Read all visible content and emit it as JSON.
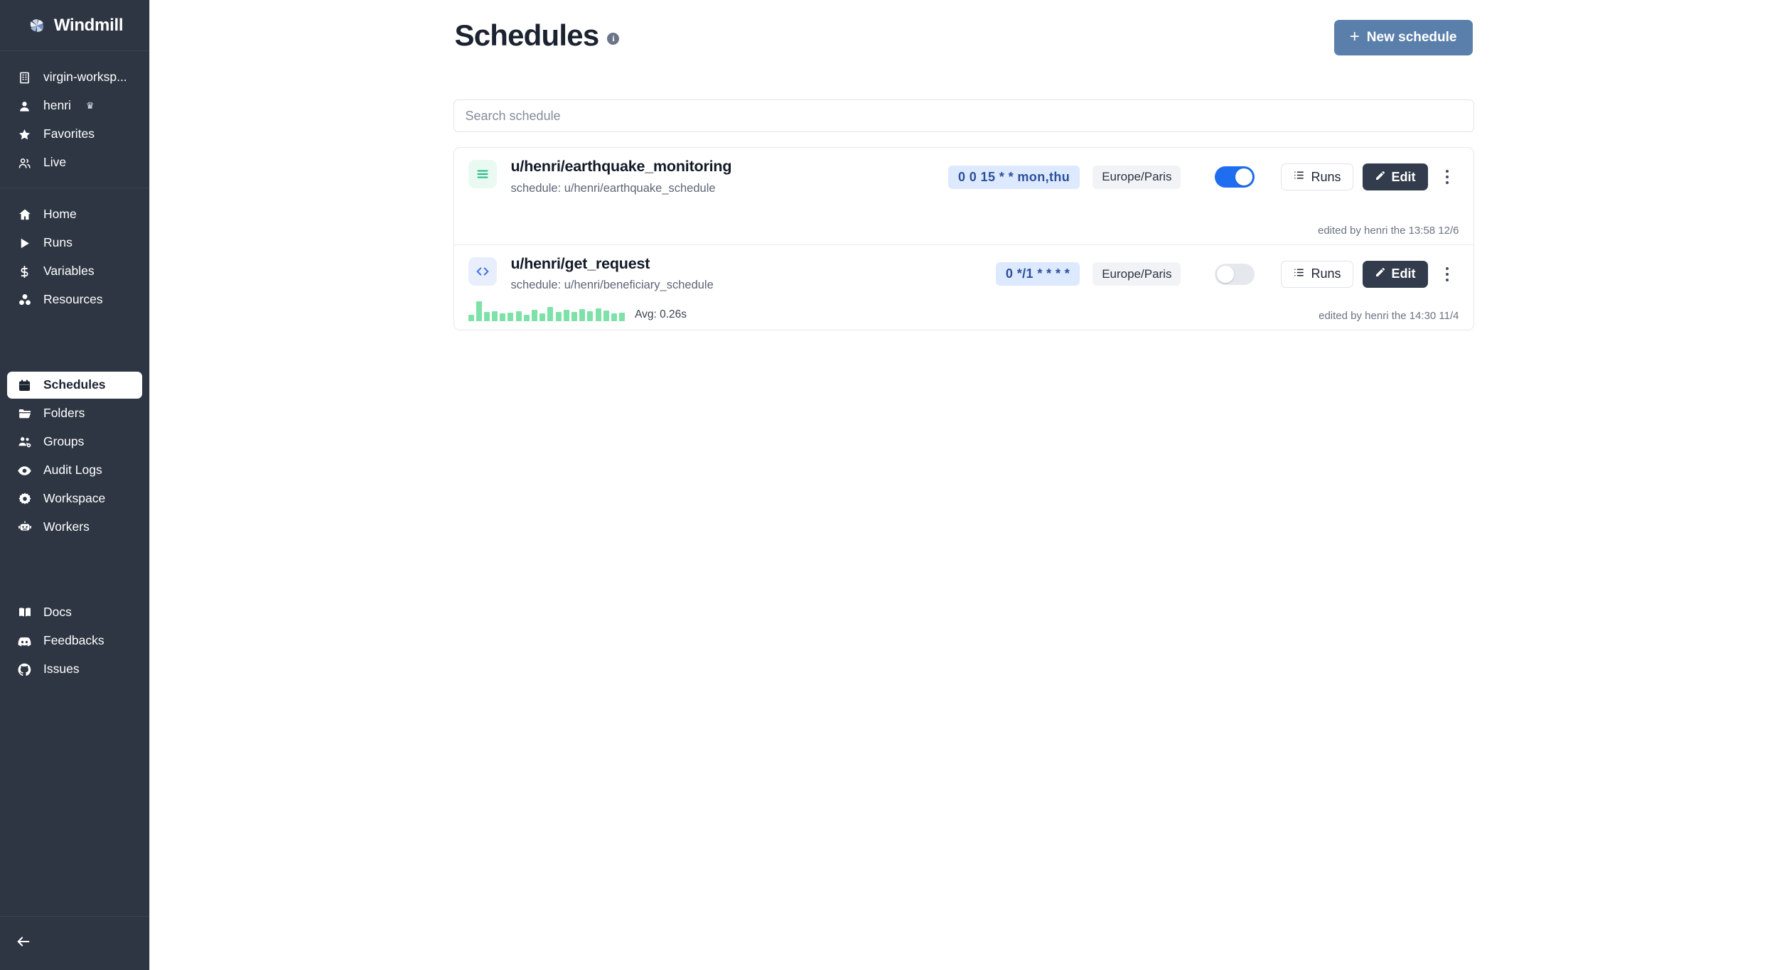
{
  "app": {
    "name": "Windmill",
    "logo_icon": "windmill-logo-icon"
  },
  "sidebar": {
    "workspace": {
      "label": "virgin-worksp...",
      "icon": "building-icon"
    },
    "user": {
      "label": "henri",
      "icon": "user-icon",
      "badge": "♛"
    },
    "top_items": [
      {
        "label": "Favorites",
        "icon": "star-icon"
      },
      {
        "label": "Live",
        "icon": "users-icon"
      }
    ],
    "main_items": [
      {
        "label": "Home",
        "icon": "home-icon"
      },
      {
        "label": "Runs",
        "icon": "play-icon"
      },
      {
        "label": "Variables",
        "icon": "dollar-icon"
      },
      {
        "label": "Resources",
        "icon": "resources-icon"
      }
    ],
    "admin_items": [
      {
        "label": "Schedules",
        "icon": "calendar-icon",
        "active": true
      },
      {
        "label": "Folders",
        "icon": "folder-icon",
        "active": false
      },
      {
        "label": "Groups",
        "icon": "groups-icon",
        "active": false
      },
      {
        "label": "Audit Logs",
        "icon": "eye-icon",
        "active": false
      },
      {
        "label": "Workspace",
        "icon": "gear-icon",
        "active": false
      },
      {
        "label": "Workers",
        "icon": "robot-icon",
        "active": false
      }
    ],
    "footer_items": [
      {
        "label": "Docs",
        "icon": "book-icon"
      },
      {
        "label": "Feedbacks",
        "icon": "discord-icon"
      },
      {
        "label": "Issues",
        "icon": "github-icon"
      }
    ],
    "collapse": {
      "icon": "arrow-left-icon"
    }
  },
  "header": {
    "title": "Schedules",
    "info_icon": "info-icon",
    "info_glyph": "i",
    "new_button": {
      "label": "New schedule",
      "icon": "plus-icon",
      "glyph": "+",
      "color": "#5b7fab"
    }
  },
  "search": {
    "placeholder": "Search schedule",
    "value": ""
  },
  "schedules": [
    {
      "kind": "flow",
      "kind_icon": "flow-icon",
      "path": "u/henri/earthquake_monitoring",
      "schedule_label": "schedule: u/henri/earthquake_schedule",
      "cron": "0 0 15 * * mon,thu",
      "timezone": "Europe/Paris",
      "enabled": true,
      "runs_label": "Runs",
      "runs_icon": "list-icon",
      "edit_label": "Edit",
      "edit_icon": "pencil-icon",
      "menu_icon": "kebab-menu-icon",
      "edited": "edited by henri the 13:58 12/6",
      "has_sparkline": false
    },
    {
      "kind": "script",
      "kind_icon": "code-icon",
      "path": "u/henri/get_request",
      "schedule_label": "schedule: u/henri/beneficiary_schedule",
      "cron": "0 */1 * * * *",
      "timezone": "Europe/Paris",
      "enabled": false,
      "runs_label": "Runs",
      "runs_icon": "list-icon",
      "edit_label": "Edit",
      "edit_icon": "pencil-icon",
      "menu_icon": "kebab-menu-icon",
      "edited": "edited by henri the 14:30 11/4",
      "has_sparkline": true,
      "avg_label": "Avg: 0.26s"
    }
  ],
  "chart_data": {
    "type": "bar",
    "title": "Recent run durations sparkline",
    "series_color": "#7ee2a8",
    "values": [
      9,
      26,
      12,
      13,
      10,
      11,
      13,
      9,
      15,
      10,
      19,
      12,
      15,
      12,
      16,
      13,
      17,
      14,
      10,
      11
    ],
    "categories": [
      "1",
      "2",
      "3",
      "4",
      "5",
      "6",
      "7",
      "8",
      "9",
      "10",
      "11",
      "12",
      "13",
      "14",
      "15",
      "16",
      "17",
      "18",
      "19",
      "20"
    ],
    "ylim": [
      0,
      28
    ],
    "xlabel": "",
    "ylabel": "",
    "grid": false,
    "annotation": "Avg: 0.26s"
  }
}
